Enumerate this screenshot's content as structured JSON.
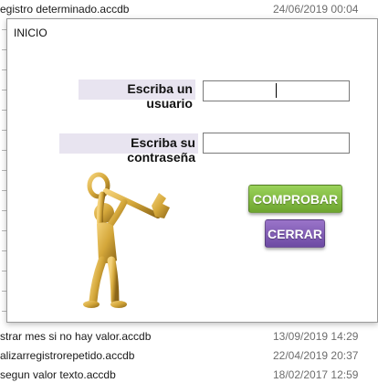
{
  "background_files": [
    {
      "name": "egistro determinado.accdb",
      "date": "24/06/2019 00:04"
    },
    {
      "name": "strar mes si no hay valor.accdb",
      "date": "13/09/2019 14:29"
    },
    {
      "name": "alizarregistrorepetido.accdb",
      "date": "22/04/2019 20:37"
    },
    {
      "name": "segun valor texto.accdb",
      "date": "18/02/2017 12:59"
    }
  ],
  "dialog": {
    "title": "INICIO",
    "user_label": "Escriba un usuario",
    "user_value": "",
    "password_label": "Escriba su contraseña",
    "password_value": "",
    "check_button": "COMPROBAR",
    "close_button": "CERRAR"
  },
  "colors": {
    "check_button": "#7cb342",
    "close_button": "#7b57b3",
    "label_background": "#e8e4f0",
    "key_figure": "#d4a73a"
  },
  "icons": {
    "figure": "key-holding-figure-icon"
  }
}
